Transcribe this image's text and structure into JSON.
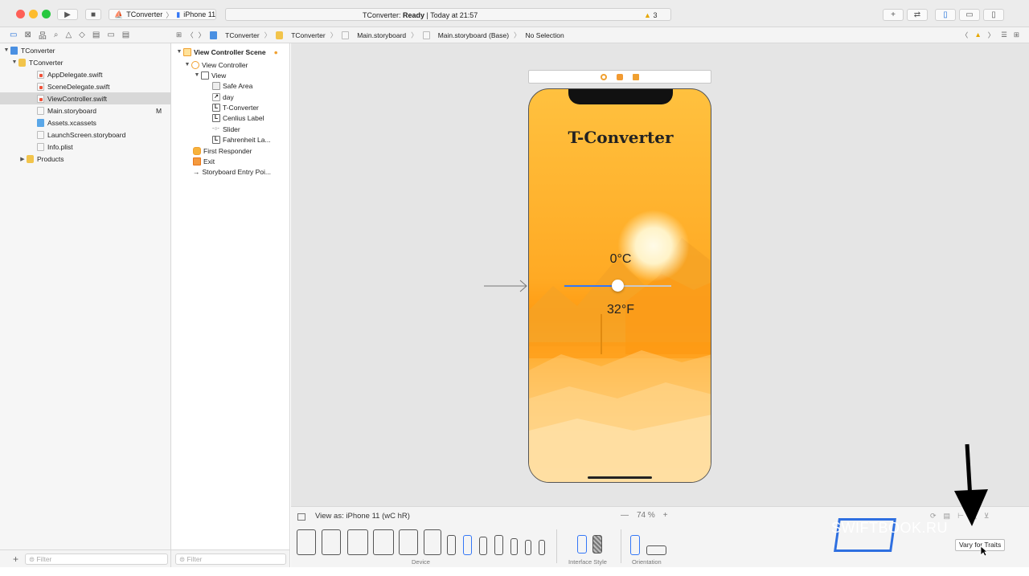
{
  "toolbar": {
    "scheme": "TConverter",
    "scheme_sep": "〉",
    "device": "iPhone 11",
    "status_app": "TConverter: ",
    "status_state": "Ready",
    "status_time": " | Today at 21:57",
    "warning_count": "3",
    "colors": {
      "close": "#fe5f57",
      "minimize": "#febc2e",
      "maximize": "#28c840",
      "accent": "#1a6bd8"
    }
  },
  "jumpbar": {
    "items": [
      "TConverter",
      "TConverter",
      "Main.storyboard",
      "Main.storyboard (Base)",
      "No Selection"
    ]
  },
  "navigator": {
    "items": [
      {
        "label": "TConverter",
        "badge": ""
      },
      {
        "label": "TConverter",
        "badge": ""
      },
      {
        "label": "AppDelegate.swift",
        "badge": ""
      },
      {
        "label": "SceneDelegate.swift",
        "badge": ""
      },
      {
        "label": "ViewController.swift",
        "badge": ""
      },
      {
        "label": "Main.storyboard",
        "badge": "M"
      },
      {
        "label": "Assets.xcassets",
        "badge": ""
      },
      {
        "label": "LaunchScreen.storyboard",
        "badge": ""
      },
      {
        "label": "Info.plist",
        "badge": ""
      },
      {
        "label": "Products",
        "badge": ""
      }
    ],
    "filter_placeholder": "Filter"
  },
  "outline": {
    "items": [
      {
        "label": "View Controller Scene"
      },
      {
        "label": "View Controller"
      },
      {
        "label": "View"
      },
      {
        "label": "Safe Area"
      },
      {
        "label": "day"
      },
      {
        "label": "T-Converter"
      },
      {
        "label": "Cenlius Label"
      },
      {
        "label": "Slider"
      },
      {
        "label": "Fahrenheit La..."
      },
      {
        "label": "First Responder"
      },
      {
        "label": "Exit"
      },
      {
        "label": "Storyboard Entry Poi..."
      }
    ],
    "filter_placeholder": "Filter"
  },
  "canvas": {
    "app_title": "T-Converter",
    "celsius": "0°C",
    "fahrenheit": "32°F",
    "slider_value": 0.5
  },
  "bottombar": {
    "view_as": "View as: iPhone 11 (wC hR)",
    "zoom_minus": "—",
    "zoom": "74 %",
    "zoom_plus": "+",
    "device_label": "Device",
    "interface_style_label": "Interface Style",
    "orientation_label": "Orientation",
    "vary_button": "Vary for Traits"
  },
  "watermark": "SWIFTBOOK.RU"
}
